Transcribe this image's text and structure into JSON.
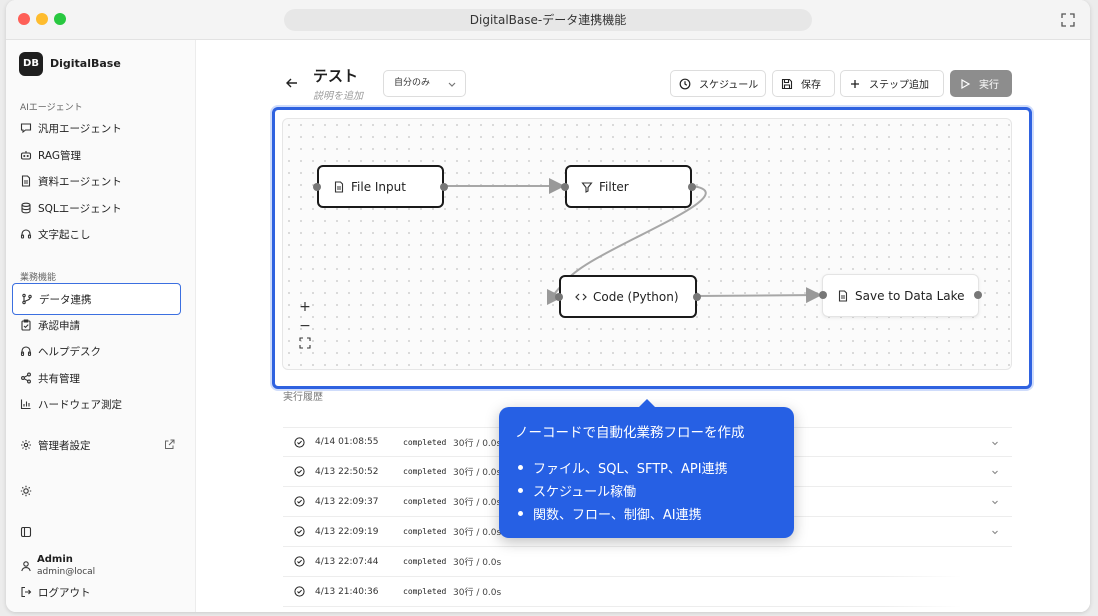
{
  "window": {
    "title": "DigitalBase-データ連携機能"
  },
  "brand": {
    "logo": "DB",
    "name": "DigitalBase"
  },
  "sidebar": {
    "section_ai": "AIエージェント",
    "ai_items": [
      {
        "label": "汎用エージェント",
        "icon": "chat-icon"
      },
      {
        "label": "RAG管理",
        "icon": "bot-icon"
      },
      {
        "label": "資料エージェント",
        "icon": "document-icon"
      },
      {
        "label": "SQLエージェント",
        "icon": "database-icon"
      },
      {
        "label": "文字起こし",
        "icon": "headset-icon"
      }
    ],
    "section_biz": "業務機能",
    "biz_items": [
      {
        "label": "データ連携",
        "icon": "git-branch-icon",
        "active": true
      },
      {
        "label": "承認申請",
        "icon": "clipboard-check-icon"
      },
      {
        "label": "ヘルプデスク",
        "icon": "headphones-icon"
      },
      {
        "label": "共有管理",
        "icon": "share-icon"
      },
      {
        "label": "ハードウェア測定",
        "icon": "bar-chart-icon"
      }
    ],
    "admin": {
      "label": "管理者設定",
      "icon": "gear-icon"
    },
    "user": {
      "name": "Admin",
      "email": "admin@local"
    },
    "logout": "ログアウト"
  },
  "header": {
    "title": "テスト",
    "description_placeholder": "説明を追加",
    "scope": "自分のみ",
    "buttons": {
      "schedule": "スケジュール",
      "save": "保存",
      "add_step": "ステップ追加",
      "run": "実行"
    }
  },
  "flow": {
    "nodes": [
      {
        "label": "File Input",
        "icon": "file-icon"
      },
      {
        "label": "Filter",
        "icon": "filter-icon"
      },
      {
        "label": "Code (Python)",
        "icon": "code-icon"
      },
      {
        "label": "Save to Data Lake",
        "icon": "file-icon"
      }
    ],
    "zoom_in": "+",
    "zoom_out": "−"
  },
  "history": {
    "label": "実行履歴",
    "rows": [
      {
        "time": "4/14 01:08:55",
        "status": "completed",
        "meta": "30行 / 0.0s"
      },
      {
        "time": "4/13 22:50:52",
        "status": "completed",
        "meta": "30行 / 0.0s"
      },
      {
        "time": "4/13 22:09:37",
        "status": "completed",
        "meta": "30行 / 0.0s"
      },
      {
        "time": "4/13 22:09:19",
        "status": "completed",
        "meta": "30行 / 0.0s"
      },
      {
        "time": "4/13 22:07:44",
        "status": "completed",
        "meta": "30行 / 0.0s"
      },
      {
        "time": "4/13 21:40:36",
        "status": "completed",
        "meta": "30行 / 0.0s"
      }
    ]
  },
  "callout": {
    "title": "ノーコードで自動化業務フローを作成",
    "items": [
      "ファイル、SQL、SFTP、API連携",
      "スケジュール稼働",
      "関数、フロー、制御、AI連携"
    ]
  },
  "colors": {
    "accent": "#2f62e0",
    "callout": "#2660e4",
    "run_button": "#8d8d8d"
  }
}
